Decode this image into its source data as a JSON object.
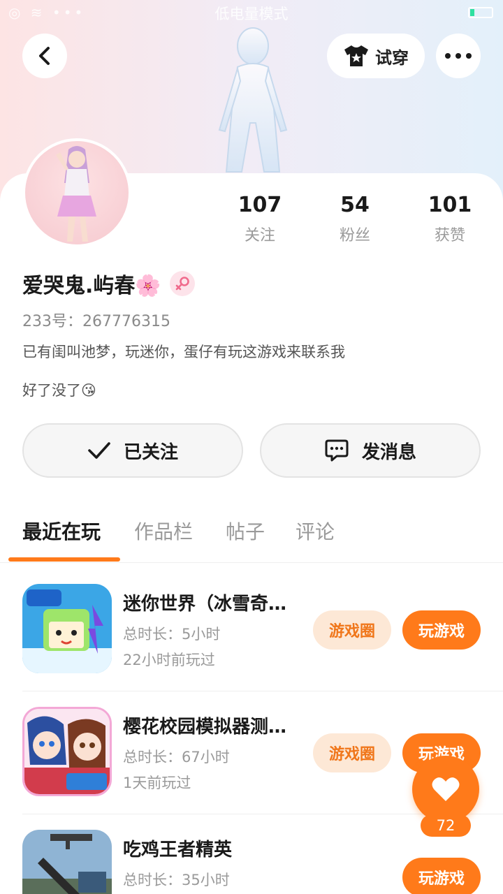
{
  "status_bar": {
    "left_icons": "◎ ≋ •••",
    "mode": "低电量模式",
    "battery_level": 0.2
  },
  "header": {
    "try_on_label": "试穿"
  },
  "profile": {
    "stats": [
      {
        "value": "107",
        "label": "关注"
      },
      {
        "value": "54",
        "label": "粉丝"
      },
      {
        "value": "101",
        "label": "获赞"
      }
    ],
    "name": "爱哭鬼.屿春🌸",
    "gender_icon": "female-icon",
    "uid": "233号：267776315",
    "bio_line1": "已有闺叫池梦，玩迷你，蛋仔有玩这游戏来联系我",
    "bio_line2": "好了没了😘"
  },
  "actions": {
    "follow_label": "已关注",
    "message_label": "发消息"
  },
  "tabs": [
    {
      "label": "最近在玩",
      "active": true
    },
    {
      "label": "作品栏",
      "active": false
    },
    {
      "label": "帖子",
      "active": false
    },
    {
      "label": "评论",
      "active": false
    }
  ],
  "games": [
    {
      "title": "迷你世界（冰雪奇缘）",
      "duration": "总时长：5小时",
      "last_played": "22小时前玩过",
      "circle_label": "游戏圈",
      "play_label": "玩游戏"
    },
    {
      "title": "樱花校园模拟器测试版",
      "duration": "总时长：67小时",
      "last_played": "1天前玩过",
      "circle_label": "游戏圈",
      "play_label": "玩游戏"
    },
    {
      "title": "吃鸡王者精英",
      "duration": "总时长：35小时",
      "last_played": "",
      "circle_label": "",
      "play_label": "玩游戏"
    }
  ],
  "like": {
    "count": "72"
  },
  "colors": {
    "accent": "#ff7a1a",
    "accent_light": "#fde8d6"
  }
}
